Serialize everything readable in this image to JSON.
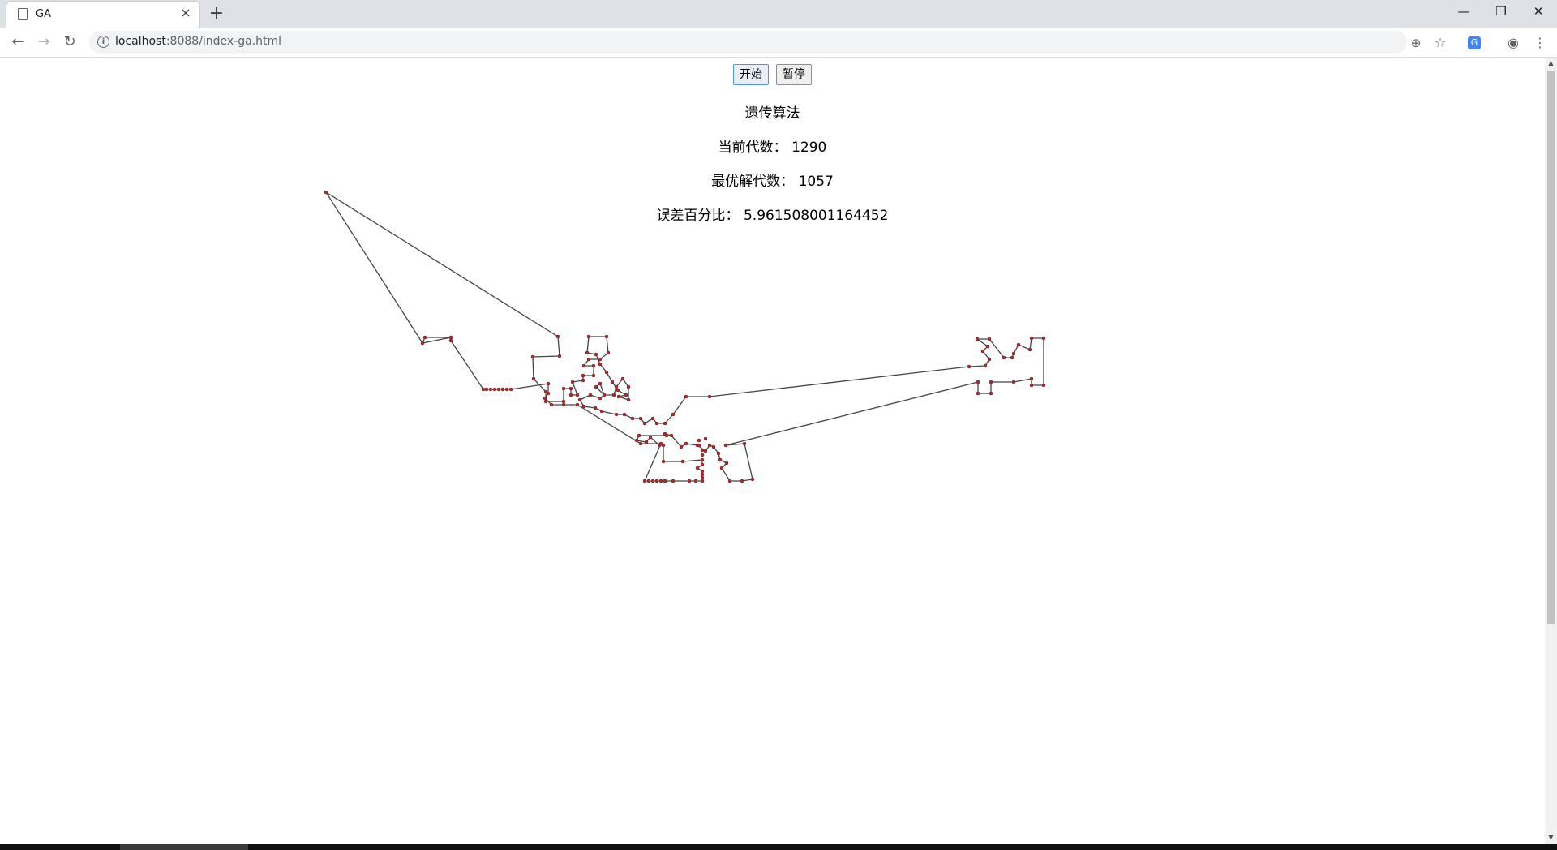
{
  "browser": {
    "tab_title": "GA",
    "url_host": "localhost",
    "url_path": ":8088/index-ga.html",
    "new_tab_symbol": "+",
    "close_tab_symbol": "×"
  },
  "page": {
    "start_button": "开始",
    "pause_button": "暂停",
    "title": "遗传算法",
    "generation_label": "当前代数：",
    "generation_value": "1290",
    "best_generation_label": "最优解代数：",
    "best_generation_value": "1057",
    "error_label": "误差百分比：",
    "error_value": "5.961508001164452"
  },
  "colors": {
    "path_line": "#444444",
    "city_point": "#cc2222",
    "focus_border": "#4d90fe"
  },
  "icons": [
    "page-icon",
    "close-icon",
    "plus-icon",
    "back-icon",
    "forward-icon",
    "reload-icon",
    "info-icon",
    "zoom-icon",
    "star-icon",
    "translate-icon",
    "account-icon",
    "menu-icon",
    "minimize-icon",
    "restore-icon",
    "window-close-icon"
  ]
}
